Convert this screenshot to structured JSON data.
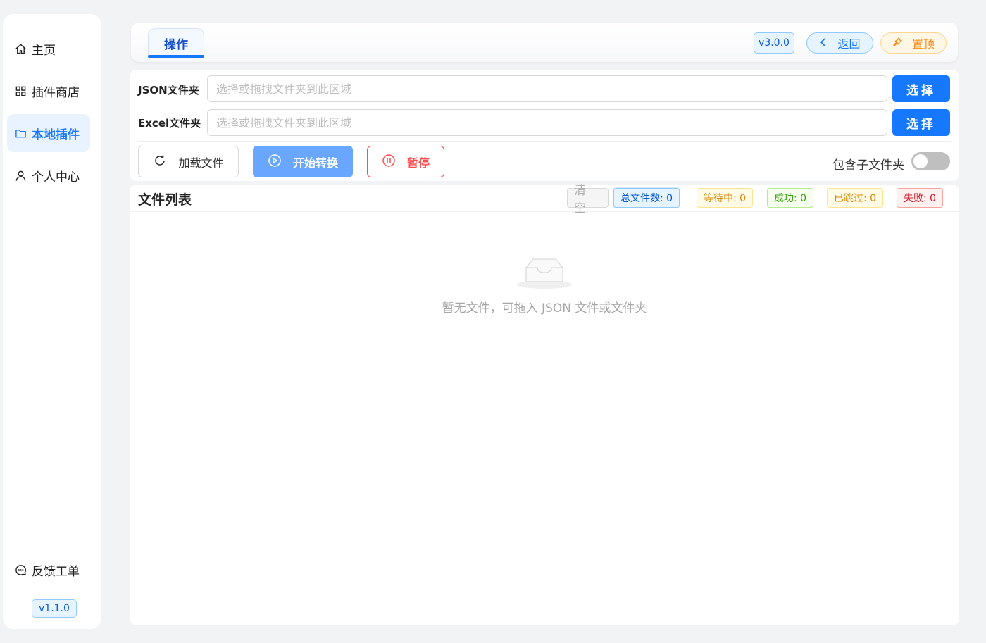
{
  "sidebar": {
    "items": [
      {
        "label": "主页",
        "icon": "home-icon"
      },
      {
        "label": "插件商店",
        "icon": "grid-icon"
      },
      {
        "label": "本地插件",
        "icon": "folder-icon",
        "active": true
      },
      {
        "label": "个人中心",
        "icon": "user-icon"
      }
    ],
    "feedback_label": "反馈工单",
    "version": "v1.1.0"
  },
  "header": {
    "tab_label": "操作",
    "version": "v3.0.0",
    "back_label": "返回",
    "pin_label": "置顶"
  },
  "form": {
    "json_label": "JSON文件夹",
    "excel_label": "Excel文件夹",
    "placeholder": "选择或拖拽文件夹到此区域",
    "choose_label": "选择",
    "load_label": "加载文件",
    "start_label": "开始转换",
    "pause_label": "暂停",
    "subfolder_label": "包含子文件夹",
    "subfolder_enabled": false
  },
  "file_list": {
    "title": "文件列表",
    "clear_label": "清空",
    "total": "总文件数: 0",
    "waiting": "等待中: 0",
    "success": "成功: 0",
    "skipped": "已跳过: 0",
    "failed": "失败: 0",
    "empty_text": "暂无文件，可拖入 JSON 文件或文件夹"
  },
  "colors": {
    "primary": "#1677ff",
    "danger": "#ff4d4f",
    "warning": "#fa8c16",
    "success": "#389e0d"
  }
}
